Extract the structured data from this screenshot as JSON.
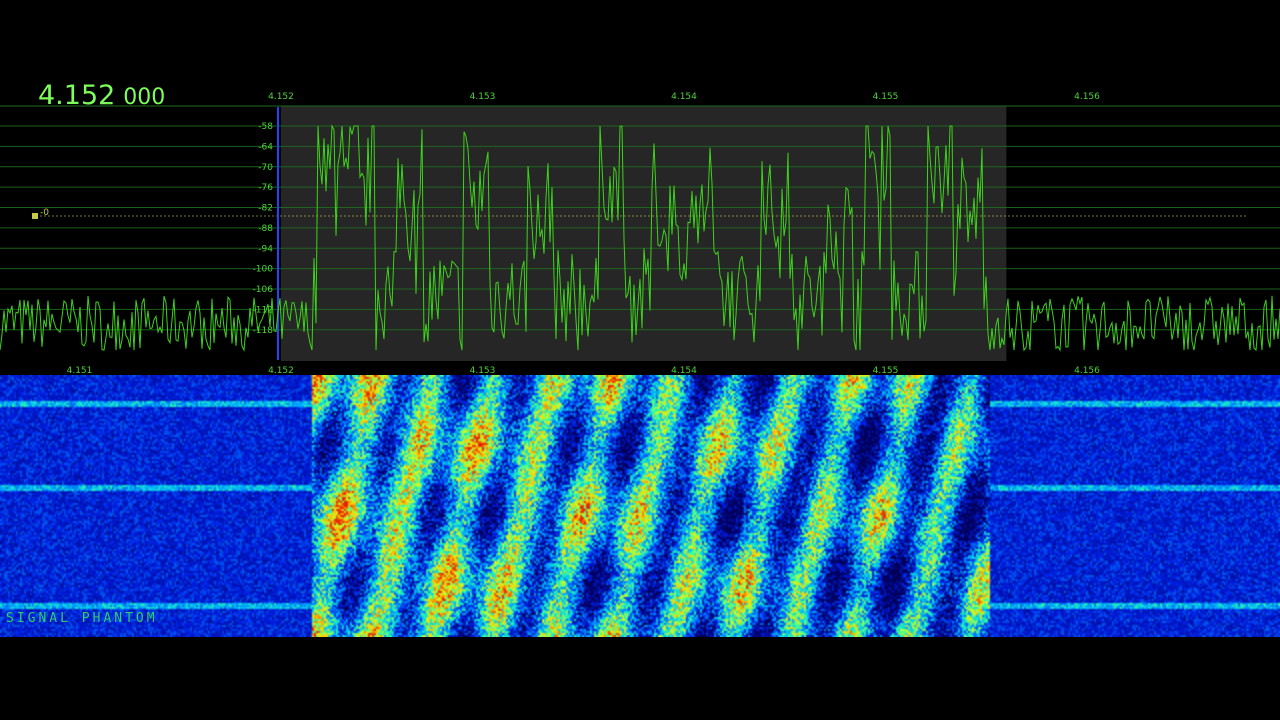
{
  "readout": {
    "mhz": "4.152",
    "hz": "000"
  },
  "colors": {
    "trace": "#3ed21a",
    "grid": "#1f6b1f",
    "label": "#4fd23a",
    "passband": "#262626",
    "marker": "#2244ff",
    "squelch": "#c8c84a",
    "watermark": "#2fcf6a"
  },
  "spectrum": {
    "freq_axis_top": {
      "ticks": [
        {
          "label": "4.152",
          "value": 4.152
        },
        {
          "label": "4.153",
          "value": 4.153
        },
        {
          "label": "4.154",
          "value": 4.154
        },
        {
          "label": "4.155",
          "value": 4.155
        },
        {
          "label": "4.156",
          "value": 4.156
        }
      ]
    },
    "freq_axis_bottom": {
      "ticks": [
        {
          "label": "4.151",
          "value": 4.151
        },
        {
          "label": "4.152",
          "value": 4.152
        },
        {
          "label": "4.153",
          "value": 4.153
        },
        {
          "label": "4.154",
          "value": 4.154
        },
        {
          "label": "4.155",
          "value": 4.155
        },
        {
          "label": "4.156",
          "value": 4.156
        }
      ]
    },
    "db_axis": {
      "ticks": [
        {
          "label": "-58",
          "value": -58
        },
        {
          "label": "-64",
          "value": -64
        },
        {
          "label": "-70",
          "value": -70
        },
        {
          "label": "-76",
          "value": -76
        },
        {
          "label": "-82",
          "value": -82
        },
        {
          "label": "-88",
          "value": -88
        },
        {
          "label": "-94",
          "value": -94
        },
        {
          "label": "-100",
          "value": -100
        },
        {
          "label": "-106",
          "value": -106
        },
        {
          "label": "-112",
          "value": -112
        },
        {
          "label": "-118",
          "value": -118
        }
      ]
    },
    "squelch": {
      "label": "-0",
      "level_db": -84.5
    },
    "tuned_frequency": 4.152,
    "passband": {
      "start": 4.152,
      "end": 4.1556
    }
  },
  "waterfall": {
    "signal_start": 4.15215,
    "signal_end": 4.15551
  },
  "watermark": "SIGNAL PHANTOM"
}
